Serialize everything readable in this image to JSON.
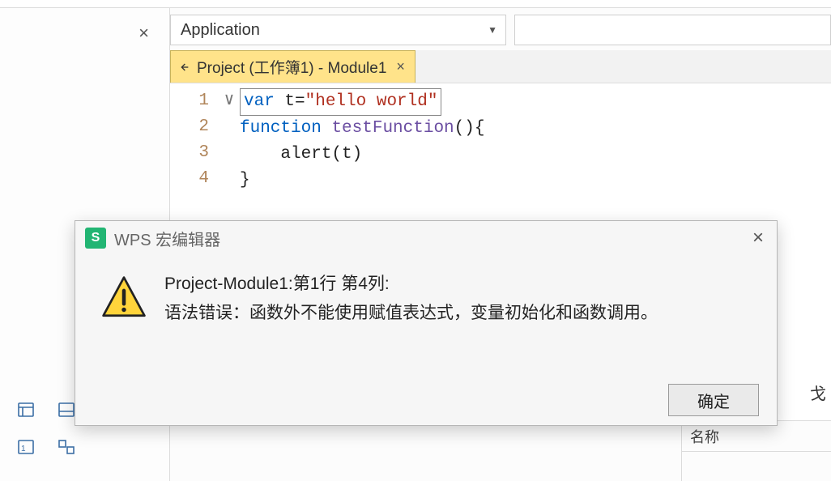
{
  "header": {
    "dropdown_selected": "Application"
  },
  "tab": {
    "label": "Project (工作簿1) - Module1"
  },
  "code": {
    "lines": [
      {
        "n": "1",
        "fold": "",
        "html": "<span class='line1-box'><span class='kw'>var</span><span class='plain'> t=</span><span class='str'>\"hello world\"</span></span>"
      },
      {
        "n": "2",
        "fold": "∨",
        "html": "<span class='kw'>function</span><span class='plain'> </span><span class='fn'>testFunction</span><span class='plain'>(){</span>"
      },
      {
        "n": "3",
        "fold": "",
        "html": "<span class='plain'>    alert(t)</span>"
      },
      {
        "n": "4",
        "fold": "",
        "html": "<span class='plain'>}</span>"
      }
    ]
  },
  "dialog": {
    "title": "WPS 宏编辑器",
    "line1": "Project-Module1:第1行 第4列:",
    "line2": "语法错误：函数外不能使用赋值表达式，变量初始化和函数调用。",
    "ok": "确定"
  },
  "bottom": {
    "right_header": "名称",
    "stat_char": "戈"
  }
}
